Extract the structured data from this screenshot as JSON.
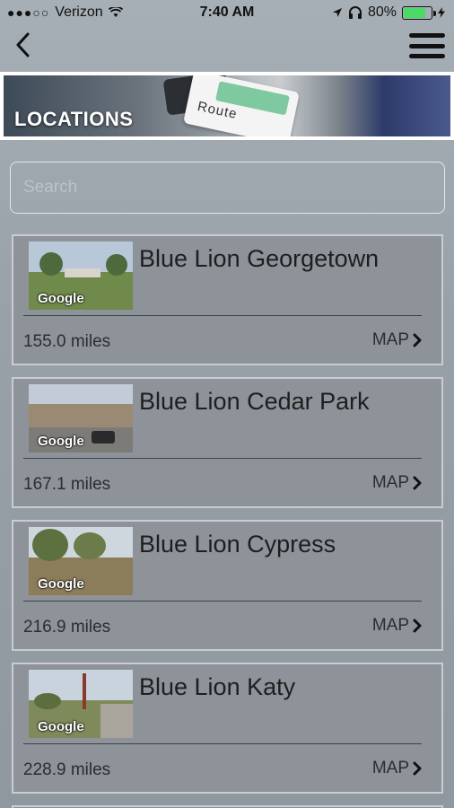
{
  "status_bar": {
    "carrier": "Verizon",
    "time": "7:40 AM",
    "battery": "80%",
    "signal_dots": "●●●○○",
    "battery_level": 0.8
  },
  "nav": {
    "back_icon": "chevron-left-icon",
    "menu_icon": "hamburger-menu-icon"
  },
  "banner": {
    "title": "LOCATIONS",
    "card_label": "Route"
  },
  "search": {
    "placeholder": "Search",
    "value": ""
  },
  "locations": [
    {
      "name": "Blue Lion Georgetown",
      "distance": "155.0 miles",
      "map_label": "MAP",
      "thumb_label": "Google"
    },
    {
      "name": "Blue Lion Cedar Park",
      "distance": "167.1 miles",
      "map_label": "MAP",
      "thumb_label": "Google"
    },
    {
      "name": "Blue Lion Cypress",
      "distance": "216.9 miles",
      "map_label": "MAP",
      "thumb_label": "Google"
    },
    {
      "name": "Blue Lion Katy",
      "distance": "228.9 miles",
      "map_label": "MAP",
      "thumb_label": "Google"
    }
  ],
  "colors": {
    "background": "#98a0a8",
    "card": "#8e9299",
    "battery_fill": "#4cd964"
  }
}
